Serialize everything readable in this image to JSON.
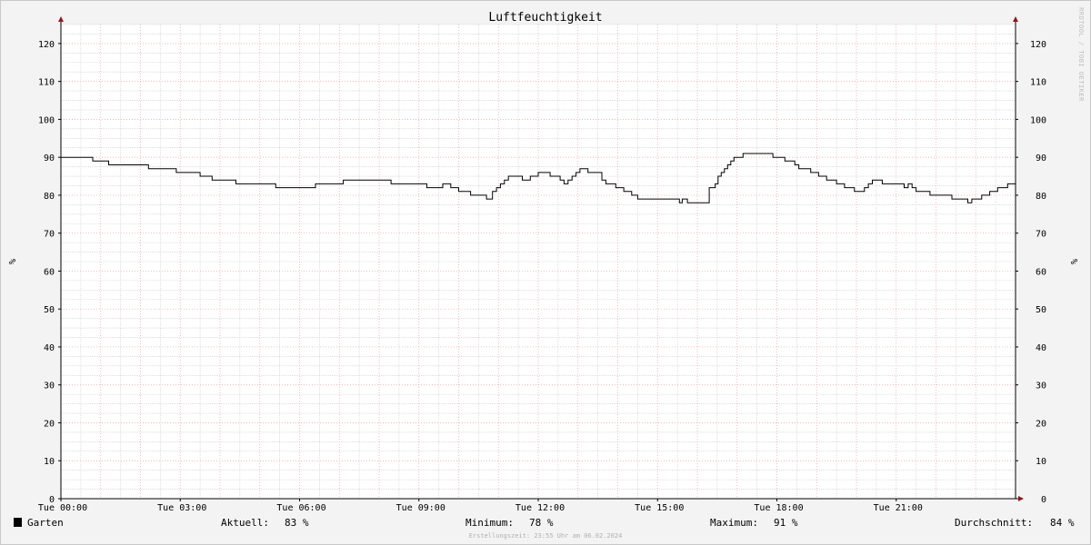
{
  "chart_data": {
    "type": "line",
    "title": "Luftfeuchtigkeit",
    "ylabel": "%",
    "ylim": [
      0,
      125
    ],
    "y_ticks": [
      0,
      10,
      20,
      30,
      40,
      50,
      60,
      70,
      80,
      90,
      100,
      110,
      120
    ],
    "x_range_hours": [
      0,
      24
    ],
    "x_ticks": [
      {
        "h": 0,
        "label": "Tue 00:00"
      },
      {
        "h": 3,
        "label": "Tue 03:00"
      },
      {
        "h": 6,
        "label": "Tue 06:00"
      },
      {
        "h": 9,
        "label": "Tue 09:00"
      },
      {
        "h": 12,
        "label": "Tue 12:00"
      },
      {
        "h": 15,
        "label": "Tue 15:00"
      },
      {
        "h": 18,
        "label": "Tue 18:00"
      },
      {
        "h": 21,
        "label": "Tue 21:00"
      }
    ],
    "grid": true,
    "series": [
      {
        "name": "Garten",
        "color": "#000000",
        "step": true,
        "points": [
          [
            0.0,
            90
          ],
          [
            0.8,
            89
          ],
          [
            1.2,
            88
          ],
          [
            2.2,
            87
          ],
          [
            2.9,
            86
          ],
          [
            3.5,
            85
          ],
          [
            3.8,
            84
          ],
          [
            4.4,
            83
          ],
          [
            5.4,
            82
          ],
          [
            6.4,
            83
          ],
          [
            7.1,
            84
          ],
          [
            8.3,
            83
          ],
          [
            9.2,
            82
          ],
          [
            9.6,
            83
          ],
          [
            9.8,
            82
          ],
          [
            10.0,
            81
          ],
          [
            10.3,
            80
          ],
          [
            10.7,
            79
          ],
          [
            10.85,
            81
          ],
          [
            10.95,
            82
          ],
          [
            11.05,
            83
          ],
          [
            11.15,
            84
          ],
          [
            11.25,
            85
          ],
          [
            11.6,
            84
          ],
          [
            11.8,
            85
          ],
          [
            12.0,
            86
          ],
          [
            12.3,
            85
          ],
          [
            12.55,
            84
          ],
          [
            12.65,
            83
          ],
          [
            12.75,
            84
          ],
          [
            12.85,
            85
          ],
          [
            12.95,
            86
          ],
          [
            13.05,
            87
          ],
          [
            13.25,
            86
          ],
          [
            13.6,
            84
          ],
          [
            13.7,
            83
          ],
          [
            13.95,
            82
          ],
          [
            14.15,
            81
          ],
          [
            14.35,
            80
          ],
          [
            14.5,
            79
          ],
          [
            15.55,
            78
          ],
          [
            15.62,
            79
          ],
          [
            15.75,
            78
          ],
          [
            16.3,
            82
          ],
          [
            16.45,
            83
          ],
          [
            16.52,
            85
          ],
          [
            16.6,
            86
          ],
          [
            16.68,
            87
          ],
          [
            16.76,
            88
          ],
          [
            16.84,
            89
          ],
          [
            16.92,
            90
          ],
          [
            17.15,
            91
          ],
          [
            17.9,
            90
          ],
          [
            18.2,
            89
          ],
          [
            18.45,
            88
          ],
          [
            18.55,
            87
          ],
          [
            18.85,
            86
          ],
          [
            19.05,
            85
          ],
          [
            19.25,
            84
          ],
          [
            19.5,
            83
          ],
          [
            19.7,
            82
          ],
          [
            19.95,
            81
          ],
          [
            20.2,
            82
          ],
          [
            20.3,
            83
          ],
          [
            20.4,
            84
          ],
          [
            20.65,
            83
          ],
          [
            21.2,
            82
          ],
          [
            21.3,
            83
          ],
          [
            21.4,
            82
          ],
          [
            21.5,
            81
          ],
          [
            21.85,
            80
          ],
          [
            22.4,
            79
          ],
          [
            22.8,
            78
          ],
          [
            22.9,
            79
          ],
          [
            23.15,
            80
          ],
          [
            23.35,
            81
          ],
          [
            23.55,
            82
          ],
          [
            23.8,
            83
          ],
          [
            24.0,
            83
          ]
        ]
      }
    ]
  },
  "watermark": "RRDTOOL / TOBI OETIKER",
  "footer": {
    "legend_name": "Garten",
    "aktuell_label": "Aktuell:",
    "aktuell_value": "83 %",
    "minimum_label": "Minimum:",
    "minimum_value": "78 %",
    "maximum_label": "Maximum:",
    "maximum_value": "91 %",
    "durchschnitt_label": "Durchschnitt:",
    "durchschnitt_value": "84 %",
    "credit": "Erstellungszeit: 23:55 Uhr am 06.02.2024"
  },
  "colors": {
    "background": "#f3f3f3",
    "plot_background": "#ffffff",
    "major_grid": "#e8a0a0",
    "minor_grid": "#c8c8c8",
    "axis": "#000000",
    "arrow": "#8b1a1a",
    "line": "#000000"
  }
}
